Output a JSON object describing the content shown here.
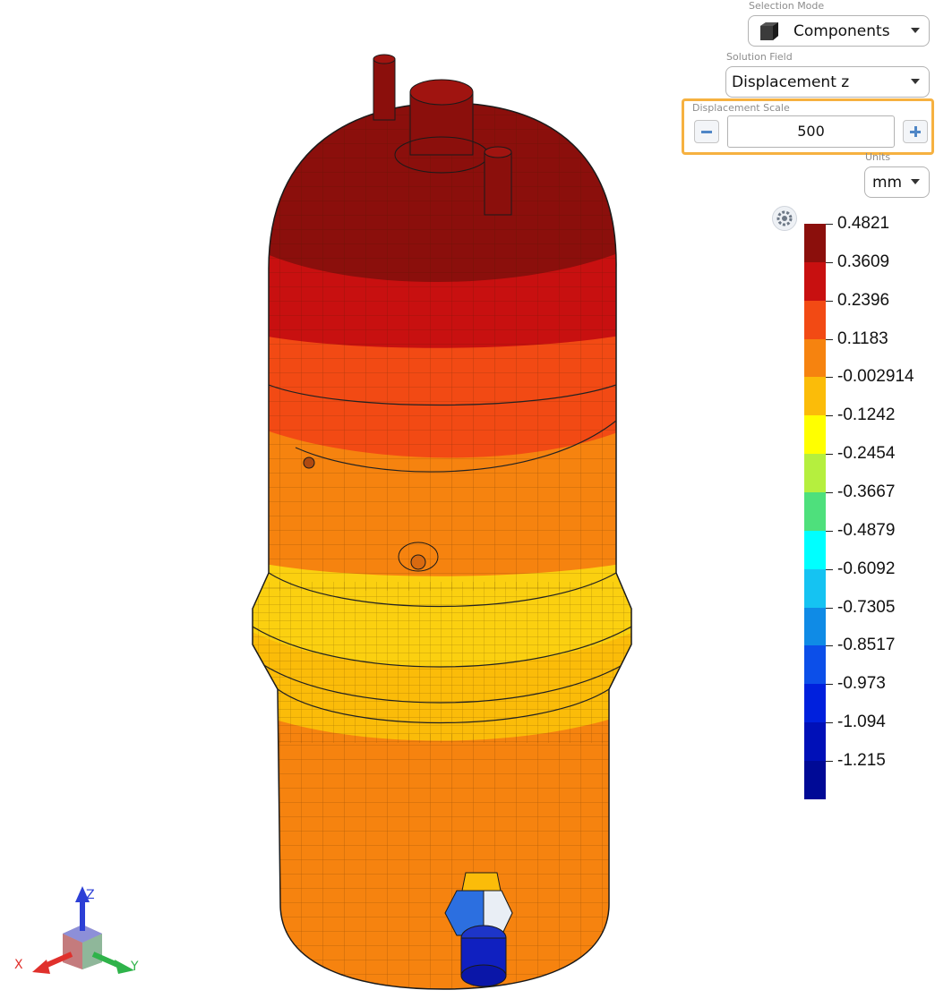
{
  "controls": {
    "selection_mode": {
      "label": "Selection Mode",
      "value": "Components",
      "icon": "cube-icon"
    },
    "solution_field": {
      "label": "Solution Field",
      "value": "Displacement z"
    },
    "displacement_scale": {
      "label": "Displacement Scale",
      "value": "500",
      "minus_icon": "minus-icon",
      "plus_icon": "plus-icon",
      "highlight_color": "#f6b140"
    },
    "units": {
      "label": "Units",
      "value": "mm"
    }
  },
  "legend": {
    "settings_icon": "gear-icon",
    "ticks": [
      "0.4821",
      "0.3609",
      "0.2396",
      "0.1183",
      "-0.002914",
      "-0.1242",
      "-0.2454",
      "-0.3667",
      "-0.4879",
      "-0.6092",
      "-0.7305",
      "-0.8517",
      "-0.973",
      "-1.094",
      "-1.215"
    ],
    "colors": [
      "#8b0f0c",
      "#c81010",
      "#f24a14",
      "#f6830f",
      "#fbbc09",
      "#ffff00",
      "#b5ef3e",
      "#4ee07c",
      "#00ffff",
      "#15c3f2",
      "#0f8be6",
      "#0c4fe9",
      "#0020dd",
      "#0010b8",
      "#000a96"
    ]
  },
  "triad": {
    "x_label": "X",
    "y_label": "Y",
    "z_label": "Z",
    "x_color": "#e0302c",
    "y_color": "#2fb34a",
    "z_color": "#2c3fd6"
  }
}
